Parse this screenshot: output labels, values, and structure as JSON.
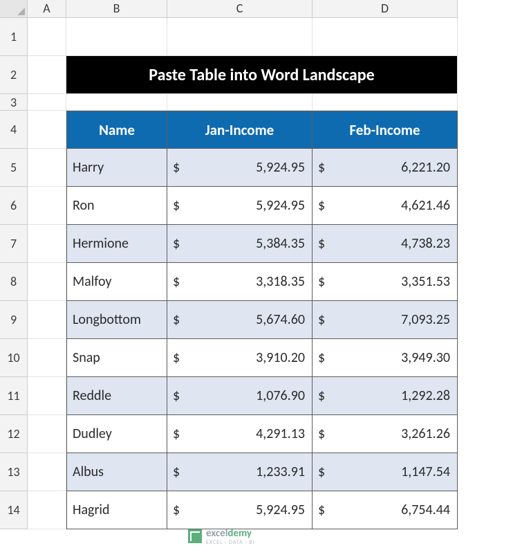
{
  "columns": [
    "A",
    "B",
    "C",
    "D"
  ],
  "row_numbers": [
    "1",
    "2",
    "3",
    "4",
    "5",
    "6",
    "7",
    "8",
    "9",
    "10",
    "11",
    "12",
    "13",
    "14"
  ],
  "title": "Paste Table into Word Landscape",
  "table": {
    "headers": {
      "name": "Name",
      "jan": "Jan-Income",
      "feb": "Feb-Income"
    },
    "currency_symbol": "$",
    "rows": [
      {
        "name": "Harry",
        "jan": "5,924.95",
        "feb": "6,221.20"
      },
      {
        "name": "Ron",
        "jan": "5,924.95",
        "feb": "4,621.46"
      },
      {
        "name": "Hermione",
        "jan": "5,384.35",
        "feb": "4,738.23"
      },
      {
        "name": "Malfoy",
        "jan": "3,318.35",
        "feb": "3,351.53"
      },
      {
        "name": "Longbottom",
        "jan": "5,674.60",
        "feb": "7,093.25"
      },
      {
        "name": "Snap",
        "jan": "3,910.20",
        "feb": "3,949.30"
      },
      {
        "name": "Reddle",
        "jan": "1,076.90",
        "feb": "1,292.28"
      },
      {
        "name": "Dudley",
        "jan": "4,291.13",
        "feb": "3,261.26"
      },
      {
        "name": "Albus",
        "jan": "1,233.91",
        "feb": "1,147.54"
      },
      {
        "name": "Hagrid",
        "jan": "5,924.95",
        "feb": "6,754.44"
      }
    ]
  },
  "watermark": {
    "brand_main": "excel",
    "brand_accent": "demy",
    "sub": "EXCEL · DATA · BI"
  },
  "chart_data": {
    "type": "table",
    "title": "Paste Table into Word Landscape",
    "columns": [
      "Name",
      "Jan-Income",
      "Feb-Income"
    ],
    "rows": [
      [
        "Harry",
        5924.95,
        6221.2
      ],
      [
        "Ron",
        5924.95,
        4621.46
      ],
      [
        "Hermione",
        5384.35,
        4738.23
      ],
      [
        "Malfoy",
        3318.35,
        3351.53
      ],
      [
        "Longbottom",
        5674.6,
        7093.25
      ],
      [
        "Snap",
        3910.2,
        3949.3
      ],
      [
        "Reddle",
        1076.9,
        1292.28
      ],
      [
        "Dudley",
        4291.13,
        3261.26
      ],
      [
        "Albus",
        1233.91,
        1147.54
      ],
      [
        "Hagrid",
        5924.95,
        6754.44
      ]
    ]
  }
}
